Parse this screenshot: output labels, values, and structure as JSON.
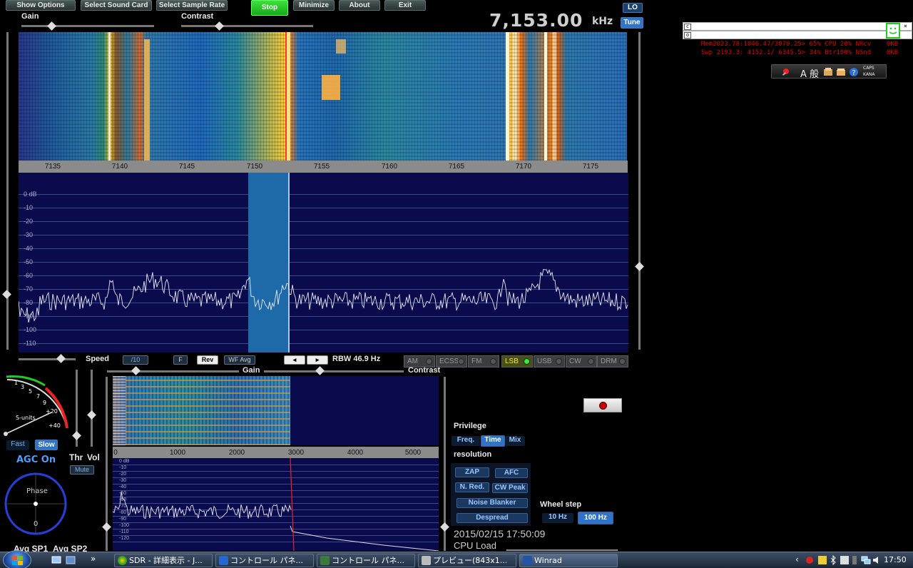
{
  "top_buttons": {
    "show_options": "Show Options",
    "select_sound_card": "Select Sound Card",
    "select_sample_rate": "Select Sample Rate",
    "stop": "Stop",
    "minimize": "Minimize",
    "about": "About",
    "exit": "Exit"
  },
  "labels": {
    "gain": "Gain",
    "contrast": "Contrast",
    "speed": "Speed",
    "speed_value": "/10",
    "f": "F",
    "rev": "Rev",
    "wf_avg": "WF Avg",
    "rbw": "RBW 46.9 Hz",
    "gain2": "Gain",
    "contrast2": "Contrast",
    "thr": "Thr",
    "vol": "Vol",
    "mute": "Mute",
    "fast": "Fast",
    "slow": "Slow",
    "agc": "AGC On",
    "phase": "Phase",
    "phase_zero": "0",
    "s_units": "S-units",
    "avg_sp1": "Avg SP1",
    "avg_sp2": "Avg SP2"
  },
  "frequency": {
    "value": "7,153.00",
    "unit": "kHz",
    "lo": "LO",
    "tune": "Tune"
  },
  "monitor": {
    "line1": "Mem2023.78:1046.47/3070.25> 65% CPU 20% NRcv    0KB",
    "line2": "Swp 2193.3: 4152.1/ 6345.5> 34% Btr100% NSnd    0KB",
    "box1": "c",
    "box2": "o",
    "close": "×"
  },
  "ime_bar": {
    "text": "A 般",
    "caps": "CAPS",
    "kana": "KANA"
  },
  "main_scale": {
    "ticks": [
      "7135",
      "7140",
      "7145",
      "7150",
      "7155",
      "7160",
      "7165",
      "7170",
      "7175"
    ]
  },
  "main_db": [
    "0 dB",
    "-10",
    "-20",
    "-30",
    "-40",
    "-50",
    "-60",
    "-70",
    "-80",
    "-90",
    "-100",
    "-110"
  ],
  "modes": [
    {
      "label": "AM",
      "active": false
    },
    {
      "label": "ECSS",
      "active": false
    },
    {
      "label": "FM",
      "active": false
    },
    {
      "label": "LSB",
      "active": true
    },
    {
      "label": "USB",
      "active": false
    },
    {
      "label": "CW",
      "active": false
    },
    {
      "label": "DRM",
      "active": false
    }
  ],
  "smeter_ticks": [
    "1",
    "3",
    "5",
    "7",
    "9",
    "+20",
    "+40"
  ],
  "audio_scale": {
    "ticks": [
      "0",
      "1000",
      "2000",
      "3000",
      "4000",
      "5000"
    ]
  },
  "audio_db": [
    "0 dB",
    "-10",
    "-20",
    "-30",
    "-40",
    "-50",
    "-60",
    "-70",
    "-80",
    "-90",
    "-100",
    "-110",
    "-120"
  ],
  "privilege": {
    "title": "Privilege",
    "freq": "Freq.",
    "time": "Time",
    "mix": "Mix",
    "resolution": "resolution"
  },
  "dsp": {
    "zap": "ZAP",
    "afc": "AFC",
    "nred": "N. Red.",
    "cwpeak": "CW Peak",
    "noise_blanker": "Noise Blanker",
    "despread": "Despread"
  },
  "wheel": {
    "title": "Wheel step",
    "hz10": "10 Hz",
    "hz100": "100 Hz"
  },
  "datetime": "2015/02/15 17:50:09",
  "cpu_load": "CPU Load",
  "taskbar": {
    "items": [
      {
        "label": "SDR - 詳細表示 - J..."
      },
      {
        "label": "コントロール パネ..."
      },
      {
        "label": "コントロール パネ..."
      },
      {
        "label": "プレビュー(843x1..."
      },
      {
        "label": "Winrad"
      }
    ],
    "time": "17:50",
    "overflow": "»"
  },
  "colors": {
    "accent_blue": "#2f74c9",
    "stop_green": "#2ac52a",
    "spectrum_bg": "#0a0b4c",
    "passband": "#1e6aa8"
  }
}
